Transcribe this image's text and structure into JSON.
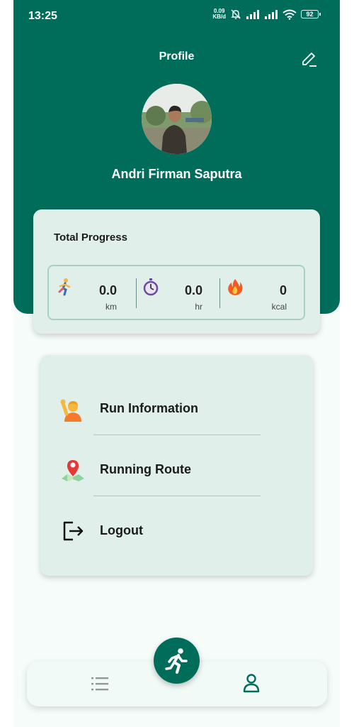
{
  "status_bar": {
    "time": "13:25",
    "net_speed_value": "0.09",
    "net_speed_unit": "KB/d",
    "battery": "92"
  },
  "header": {
    "title": "Profile",
    "user_name": "Andri Firman Saputra"
  },
  "progress": {
    "title": "Total Progress",
    "stats": [
      {
        "icon": "runner-icon",
        "value": "0.0",
        "unit": "km"
      },
      {
        "icon": "stopwatch-icon",
        "value": "0.0",
        "unit": "hr"
      },
      {
        "icon": "fire-icon",
        "value": "0",
        "unit": "kcal"
      }
    ]
  },
  "menu": {
    "items": [
      {
        "label": "Run Information",
        "icon": "person-raising-hand-icon"
      },
      {
        "label": "Running Route",
        "icon": "map-pin-icon"
      },
      {
        "label": "Logout",
        "icon": "logout-icon"
      }
    ]
  },
  "bottom_nav": {
    "items": [
      "list-icon",
      "run-icon",
      "profile-icon"
    ],
    "active": "profile-icon"
  },
  "colors": {
    "primary": "#006d5b",
    "card_bg": "#e1efeb",
    "page_bg": "#f6fcfa"
  }
}
